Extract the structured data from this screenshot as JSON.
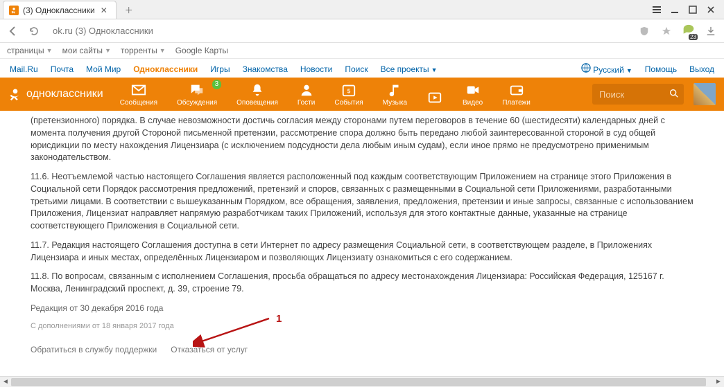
{
  "browser": {
    "tab_title": "(3) Одноклассники",
    "url": "ok.ru  (3) Одноклассники"
  },
  "bookmarks": {
    "items": [
      "страницы",
      "мои сайты",
      "торренты",
      "Google Карты"
    ]
  },
  "mailru": {
    "items": [
      "Mail.Ru",
      "Почта",
      "Мой Мир",
      "Одноклассники",
      "Игры",
      "Знакомства",
      "Новости",
      "Поиск",
      "Все проекты"
    ],
    "lang": "Русский",
    "help": "Помощь",
    "logout": "Выход"
  },
  "ok": {
    "logo": "одноклассники",
    "nav": [
      {
        "label": "Сообщения",
        "icon": "mail"
      },
      {
        "label": "Обсуждения",
        "icon": "chat",
        "badge": "3"
      },
      {
        "label": "Оповещения",
        "icon": "bell"
      },
      {
        "label": "Гости",
        "icon": "person"
      },
      {
        "label": "События",
        "icon": "calendar"
      },
      {
        "label": "Музыка",
        "icon": "note"
      },
      {
        "label": "",
        "icon": "play"
      },
      {
        "label": "Видео",
        "icon": "video"
      },
      {
        "label": "Платежи",
        "icon": "wallet"
      }
    ],
    "search_placeholder": "Поиск"
  },
  "doc": {
    "p1": "(претензионного) порядка. В случае невозможности достичь согласия между сторонами путем переговоров в течение 60 (шестидесяти) календарных дней с момента получения другой Стороной письменной претензии, рассмотрение спора должно быть передано любой заинтересованной стороной в суд общей юрисдикции по месту нахождения Лицензиара (с исключением подсудности дела любым иным судам), если иное прямо не предусмотрено применимым законодательством.",
    "p2": "11.6. Неотъемлемой частью настоящего Соглашения является расположенный под каждым соответствующим Приложением на странице этого Приложения в Социальной сети Порядок рассмотрения предложений, претензий и споров, связанных с размещенными в Социальной сети Приложениями, разработанными третьими лицами. В соответствии с вышеуказанным Порядком, все обращения, заявления, предложения, претензии и иные запросы, связанные с использованием Приложения, Лицензиат направляет напрямую разработчикам таких Приложений, используя для этого контактные данные, указанные на странице соответствующего Приложения в Социальной сети.",
    "p3": "11.7. Редакция настоящего Соглашения доступна в сети Интернет по адресу размещения Социальной сети, в соответствующем разделе, в Приложениях Лицензиара и иных местах, определённых Лицензиаром и позволяющих Лицензиату ознакомиться с его содержанием.",
    "p4": "11.8. По вопросам, связанным с исполнением Соглашения, просьба обращаться по адресу местонахождения Лицензиара: Российская Федерация, 125167 г. Москва, Ленинградский проспект, д. 39, строение 79.",
    "date_main": "Редакция от 30 декабря 2016 года",
    "date_sub": "С дополнениями от 18 января 2017 года",
    "support_link": "Обратиться в службу поддержки",
    "optout_link": "Отказаться от услуг"
  },
  "annotation": {
    "label": "1"
  }
}
